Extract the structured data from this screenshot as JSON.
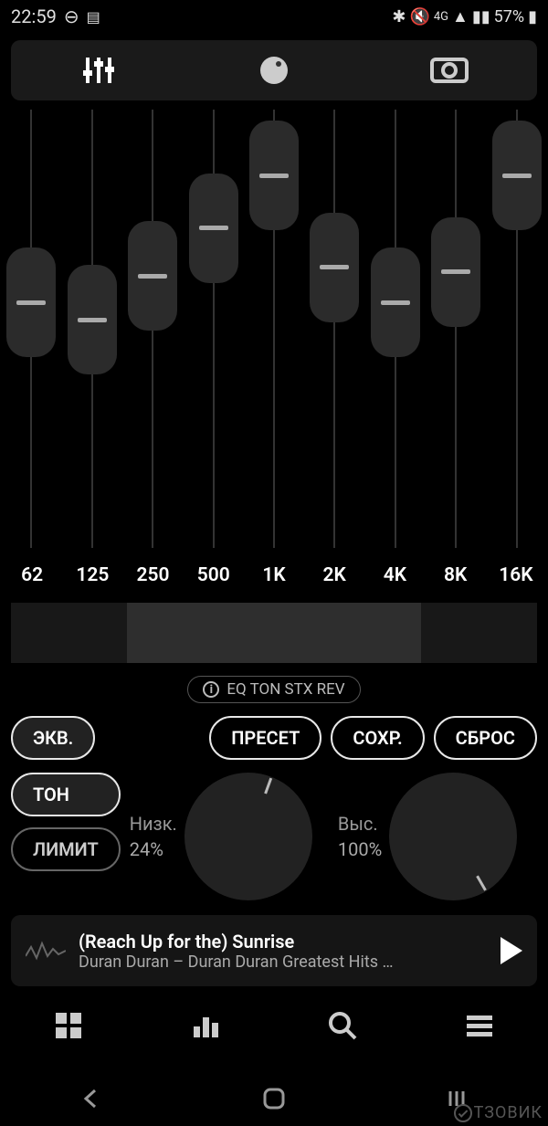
{
  "status": {
    "time": "22:59",
    "battery": "57%"
  },
  "eq": {
    "bands": [
      {
        "freq": "62",
        "pos": 44
      },
      {
        "freq": "125",
        "pos": 48
      },
      {
        "freq": "250",
        "pos": 38
      },
      {
        "freq": "500",
        "pos": 27
      },
      {
        "freq": "1K",
        "pos": 15
      },
      {
        "freq": "2K",
        "pos": 36
      },
      {
        "freq": "4K",
        "pos": 44
      },
      {
        "freq": "8K",
        "pos": 37
      },
      {
        "freq": "16K",
        "pos": 15
      }
    ],
    "preamp_start_pct": 22,
    "preamp_width_pct": 56
  },
  "info_chip": "EQ TON STX REV",
  "buttons": {
    "ekv": "ЭКВ.",
    "preset": "ПРЕСЕТ",
    "save": "СОХР.",
    "reset": "СБРОС",
    "tone": "ТОН",
    "limit": "ЛИМИТ"
  },
  "knobs": {
    "low": {
      "label": "Низк.",
      "value": "24%",
      "angle": 200
    },
    "high": {
      "label": "Выс.",
      "value": "100%",
      "angle": 330
    }
  },
  "now_playing": {
    "title": "(Reach Up for the) Sunrise",
    "artist": "Duran Duran – Duran Duran Greatest Hits …"
  },
  "watermark": "ТЗОВИК"
}
